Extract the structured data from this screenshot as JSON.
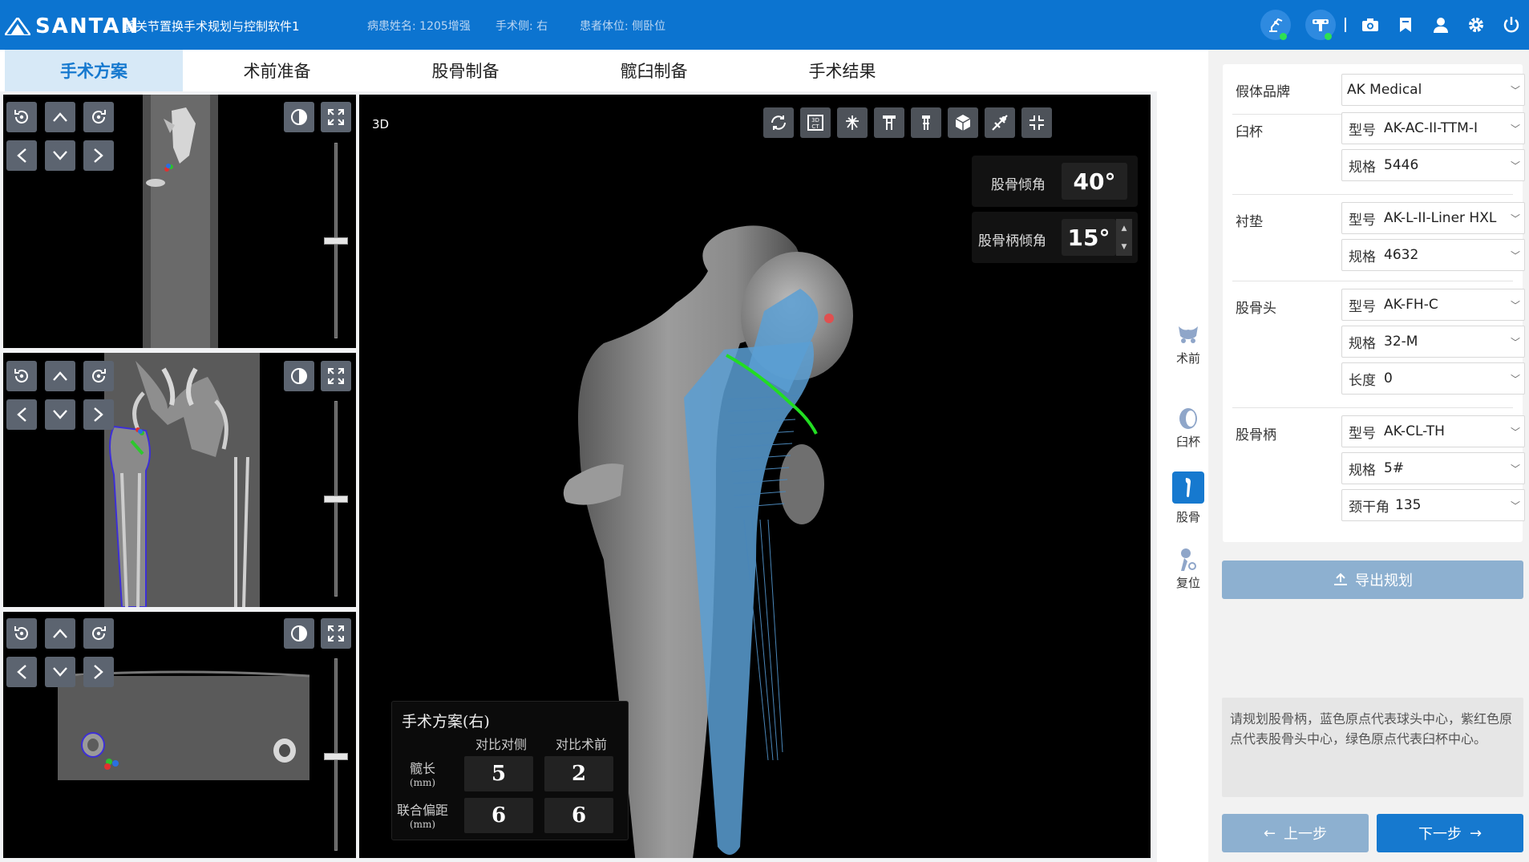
{
  "header": {
    "brand": "SANTAN",
    "app_title": "髋关节置换手术规划与控制软件1",
    "patient": "病患姓名: 1205增强",
    "side": "手术侧: 右",
    "position": "患者体位: 侧卧位",
    "icons": [
      "robot-arm-icon",
      "tracker-icon",
      "camera-icon",
      "bookmark-icon",
      "user-icon",
      "gear-icon",
      "power-icon"
    ]
  },
  "tabs": [
    "手术方案",
    "术前准备",
    "股骨制备",
    "髋臼制备",
    "手术结果"
  ],
  "views": {
    "label_3d": "3D"
  },
  "angles": {
    "femur_tilt_label": "股骨倾角",
    "femur_tilt_value": "40°",
    "stem_tilt_label": "股骨柄倾角",
    "stem_tilt_value": "15°"
  },
  "plan": {
    "title": "手术方案(右)",
    "col1": "对比对侧",
    "col2": "对比术前",
    "row1_label": "髋长",
    "row1_unit": "(mm)",
    "row2_label": "联合偏距",
    "row2_unit": "(mm)",
    "r1c1": "5",
    "r1c2": "2",
    "r2c1": "6",
    "r2c2": "6"
  },
  "sidebar": [
    {
      "label": "术前",
      "icon": "pelvis-icon"
    },
    {
      "label": "臼杯",
      "icon": "cup-icon"
    },
    {
      "label": "股骨",
      "icon": "femur-icon"
    },
    {
      "label": "复位",
      "icon": "reduction-icon"
    }
  ],
  "prosthesis": {
    "brand_label": "假体品牌",
    "brand_value": "AK Medical",
    "cup_label": "臼杯",
    "cup_model_key": "型号",
    "cup_model": "AK-AC-II-TTM-I",
    "cup_size_key": "规格",
    "cup_size": "5446",
    "liner_label": "衬垫",
    "liner_model_key": "型号",
    "liner_model": "AK-L-II-Liner HXL",
    "liner_size_key": "规格",
    "liner_size": "4632",
    "head_label": "股骨头",
    "head_model_key": "型号",
    "head_model": "AK-FH-C",
    "head_size_key": "规格",
    "head_size": "32-M",
    "head_len_key": "长度",
    "head_len": "0",
    "stem_label": "股骨柄",
    "stem_model_key": "型号",
    "stem_model": "AK-CL-TH",
    "stem_size_key": "规格",
    "stem_size": "5#",
    "stem_angle_key": "颈干角",
    "stem_angle": "135"
  },
  "buttons": {
    "export": "导出规划",
    "prev": "上一步",
    "next": "下一步"
  },
  "hint": "请规划股骨柄，蓝色原点代表球头中心，紫红色原点代表股骨头中心，绿色原点代表臼杯中心。",
  "colors": {
    "brand_blue": "#0c74d0",
    "accent": "#1679cf",
    "implant": "#5b9fd4",
    "cut_line": "#22dd22"
  }
}
